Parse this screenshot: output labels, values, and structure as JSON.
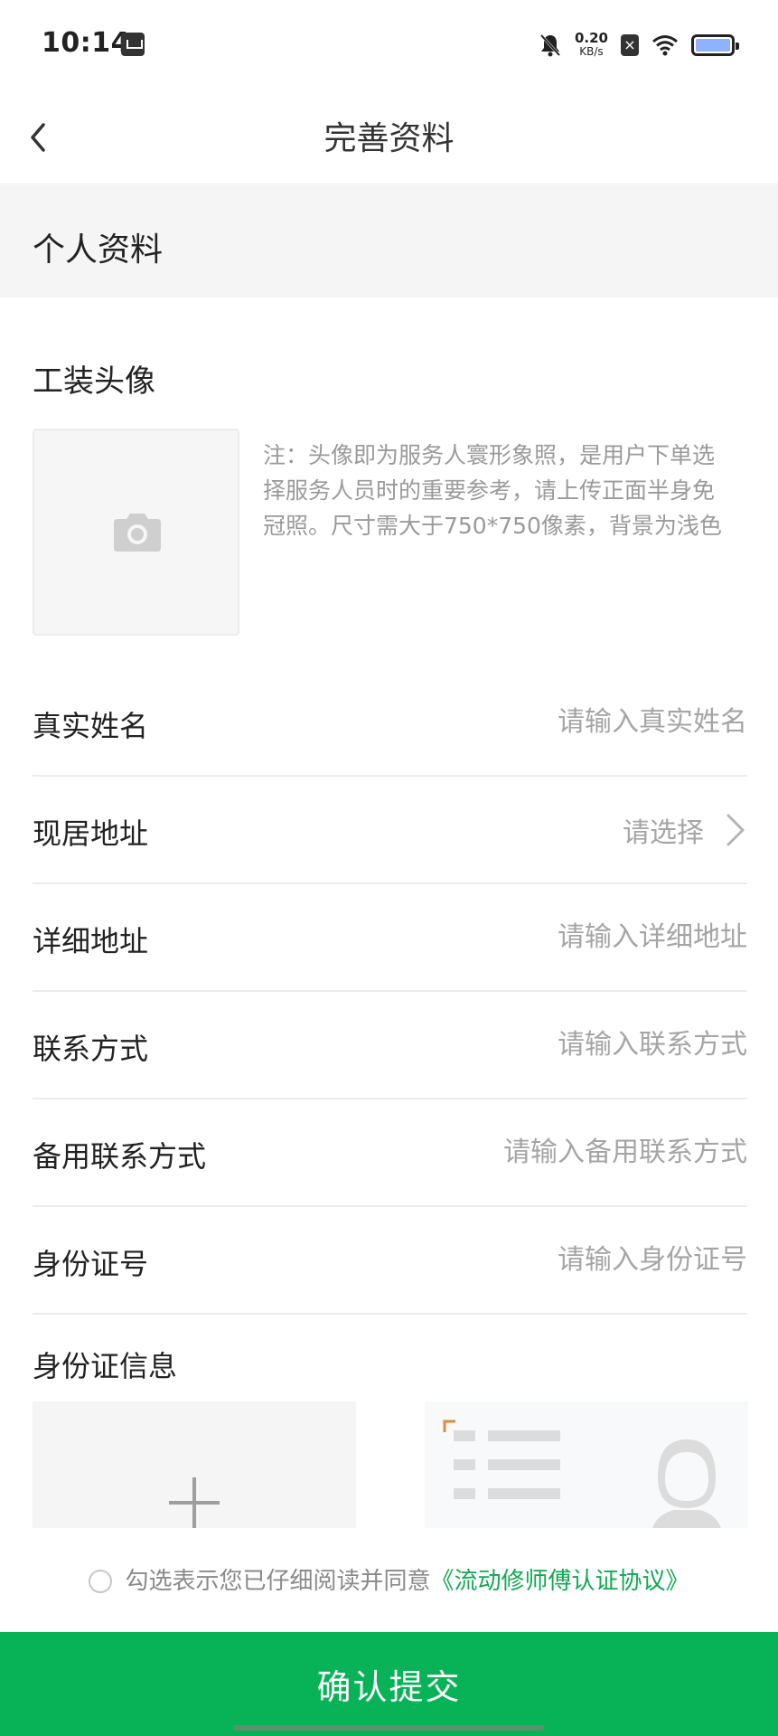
{
  "status_bar": {
    "time": "10:14",
    "net_speed_value": "0.20",
    "net_speed_unit": "KB/s",
    "sim_badge": "×",
    "icons": [
      "app-notification-icon",
      "mute-bell-icon",
      "no-sim-icon",
      "wifi-icon",
      "battery-icon"
    ]
  },
  "nav": {
    "title": "完善资料",
    "back_icon": "chevron-left-icon"
  },
  "section": {
    "title": "个人资料"
  },
  "avatar": {
    "label": "工装头像",
    "note": "注：头像即为服务人寰形象照，是用户下单选择服务人员时的重要参考，请上传正面半身免冠照。尺寸需大于750*750像素，背景为浅色",
    "icon": "camera-icon"
  },
  "form": {
    "rows": [
      {
        "label": "真实姓名",
        "placeholder": "请输入真实姓名",
        "value": ""
      },
      {
        "label": "现居地址",
        "select_text": "请选择"
      },
      {
        "label": "详细地址",
        "placeholder": "请输入详细地址",
        "value": ""
      },
      {
        "label": "联系方式",
        "placeholder": "请输入联系方式",
        "value": ""
      },
      {
        "label": "备用联系方式",
        "placeholder": "请输入备用联系方式",
        "value": ""
      },
      {
        "label": "身份证号",
        "placeholder": "请输入身份证号",
        "value": ""
      }
    ]
  },
  "id_card": {
    "label": "身份证信息"
  },
  "agreement": {
    "text": "勾选表示您已仔细阅读并同意",
    "link": "《流动修师傅认证协议》",
    "checked": false
  },
  "submit": {
    "label": "确认提交"
  },
  "colors": {
    "primary_green": "#07b356",
    "link_green": "#12a852",
    "section_bg": "#f5f5f5",
    "placeholder_gray": "#a5a5a5",
    "divider": "#ececec"
  }
}
